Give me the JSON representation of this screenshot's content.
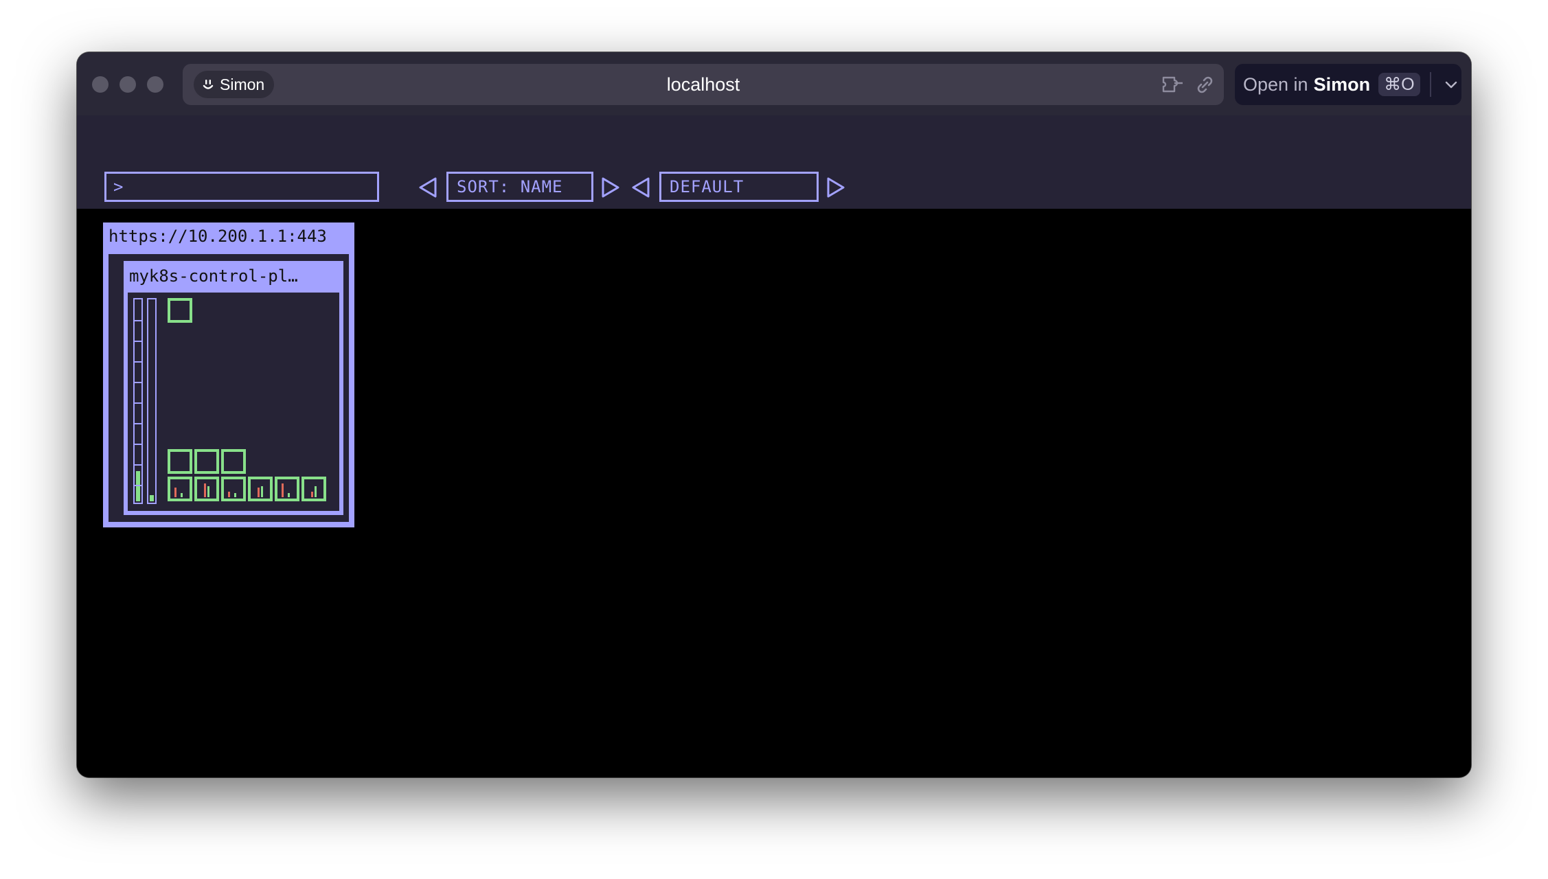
{
  "browser": {
    "profile_name": "Simon",
    "host": "localhost",
    "open_prefix": "Open in",
    "open_app": "Simon",
    "shortcut": "⌘O",
    "icons": [
      "smile-icon",
      "extension-icon",
      "link-icon",
      "chevron-down-icon"
    ]
  },
  "toolbar": {
    "command_prompt": ">",
    "sort_label": "SORT: NAME",
    "namespace_label": "DEFAULT"
  },
  "cluster": {
    "url": "https://10.200.1.1:443",
    "node": {
      "name": "myk8s-control-pl…",
      "cpu_usage": 0.15,
      "memory_usage": 0.03,
      "pods": [
        {
          "row": 1,
          "col": 1,
          "status": "running"
        },
        {
          "row": 2,
          "col": 1,
          "status": "running"
        },
        {
          "row": 2,
          "col": 2,
          "status": "running"
        },
        {
          "row": 2,
          "col": 3,
          "status": "running"
        },
        {
          "row": 3,
          "col": 1,
          "status": "running"
        },
        {
          "row": 3,
          "col": 2,
          "status": "running"
        },
        {
          "row": 3,
          "col": 3,
          "status": "running"
        },
        {
          "row": 3,
          "col": 4,
          "status": "running"
        },
        {
          "row": 3,
          "col": 5,
          "status": "running"
        },
        {
          "row": 3,
          "col": 6,
          "status": "running"
        }
      ]
    }
  },
  "colors": {
    "accent": "#a3a2ff",
    "pod_ok": "#88e08a",
    "cpu_marker": "#e06a5a",
    "panel_bg": "#262336"
  }
}
